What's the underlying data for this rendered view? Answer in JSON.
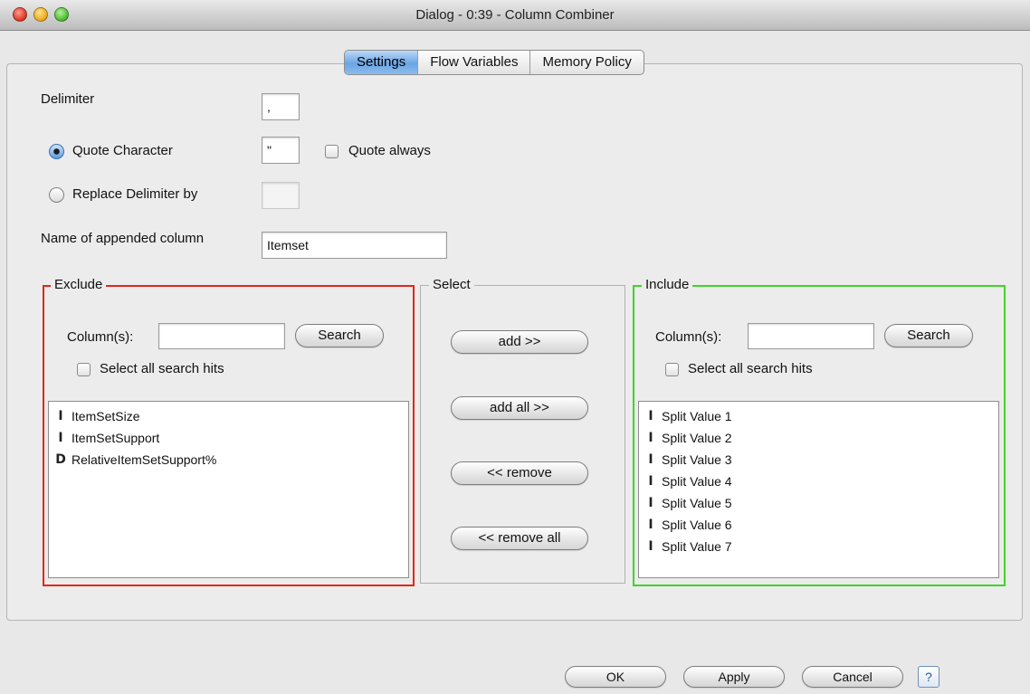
{
  "window": {
    "title": "Dialog - 0:39 - Column Combiner"
  },
  "tabs": [
    {
      "label": "Settings",
      "active": true
    },
    {
      "label": "Flow Variables",
      "active": false
    },
    {
      "label": "Memory Policy",
      "active": false
    }
  ],
  "settings": {
    "delimiter_label": "Delimiter",
    "delimiter_value": ",",
    "quote_char_label": "Quote Character",
    "quote_char_value": "\"",
    "quote_char_selected": true,
    "quote_always_label": "Quote always",
    "quote_always_checked": false,
    "replace_delim_label": "Replace Delimiter by",
    "replace_delim_value": "",
    "replace_delim_selected": false,
    "append_col_label": "Name of appended column",
    "append_col_value": "Itemset"
  },
  "exclude": {
    "title": "Exclude",
    "columns_label": "Column(s):",
    "search_value": "",
    "search_button": "Search",
    "select_all_label": "Select all search hits",
    "items": [
      {
        "type_icon": "I",
        "label": "ItemSetSize"
      },
      {
        "type_icon": "I",
        "label": "ItemSetSupport"
      },
      {
        "type_icon": "D",
        "label": "RelativeItemSetSupport%"
      }
    ]
  },
  "select": {
    "title": "Select",
    "add_label": "add >>",
    "add_all_label": "add all >>",
    "remove_label": "<< remove",
    "remove_all_label": "<< remove all"
  },
  "include": {
    "title": "Include",
    "columns_label": "Column(s):",
    "search_value": "",
    "search_button": "Search",
    "select_all_label": "Select all search hits",
    "items": [
      {
        "type_icon": "I",
        "label": "Split Value 1"
      },
      {
        "type_icon": "I",
        "label": "Split Value 2"
      },
      {
        "type_icon": "I",
        "label": "Split Value 3"
      },
      {
        "type_icon": "I",
        "label": "Split Value 4"
      },
      {
        "type_icon": "I",
        "label": "Split Value 5"
      },
      {
        "type_icon": "I",
        "label": "Split Value 6"
      },
      {
        "type_icon": "I",
        "label": "Split Value 7"
      }
    ]
  },
  "footer": {
    "ok_label": "OK",
    "apply_label": "Apply",
    "cancel_label": "Cancel",
    "help_label": "?"
  }
}
